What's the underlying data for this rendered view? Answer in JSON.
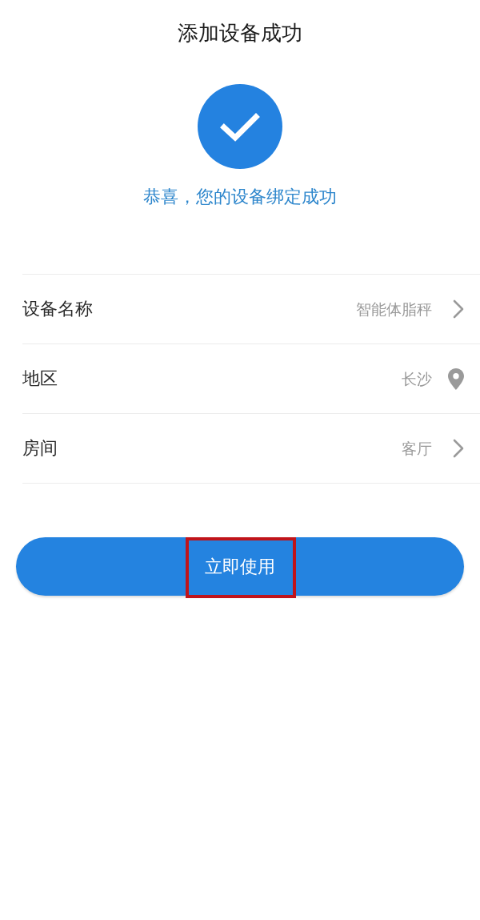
{
  "header": {
    "title": "添加设备成功"
  },
  "success": {
    "message": "恭喜，您的设备绑定成功"
  },
  "settings": [
    {
      "label": "设备名称",
      "value": "智能体脂秤",
      "kind": "link"
    },
    {
      "label": "地区",
      "value": "长沙",
      "kind": "location"
    },
    {
      "label": "房间",
      "value": "客厅",
      "kind": "link"
    }
  ],
  "primary_button": {
    "label": "立即使用",
    "highlighted": true
  }
}
